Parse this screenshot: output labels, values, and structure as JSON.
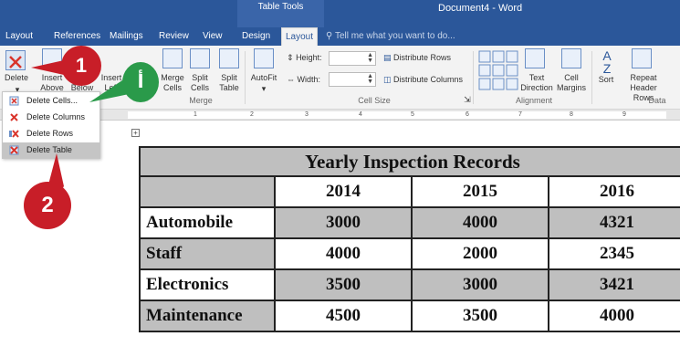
{
  "titlebar": {
    "context_tab": "Table Tools",
    "document_title": "Document4 - Word"
  },
  "tabs": [
    "Layout",
    "References",
    "Mailings",
    "Review",
    "View",
    "Design",
    "Layout"
  ],
  "tell_me": "Tell me what you want to do...",
  "ribbon": {
    "delete": "Delete",
    "insert_above": "Insert Above",
    "insert_below": "Below",
    "insert_left": "Insert Left",
    "merge_cells": "Merge Cells",
    "split_cells": "Split Cells",
    "split_table": "Split Table",
    "autofit": "AutoFit",
    "height": "Height:",
    "width": "Width:",
    "distribute_rows": "Distribute Rows",
    "distribute_columns": "Distribute Columns",
    "text_direction": "Text Direction",
    "cell_margins": "Cell Margins",
    "sort": "Sort",
    "repeat_header_rows": "Repeat Header Rows",
    "group_merge": "Merge",
    "group_cell_size": "Cell Size",
    "group_alignment": "Alignment",
    "group_data": "Data"
  },
  "menu": {
    "items": [
      "Delete Cells...",
      "Delete Columns",
      "Delete Rows",
      "Delete Table"
    ]
  },
  "callouts": {
    "one": "1",
    "two": "2",
    "alef": "أ"
  },
  "table": {
    "title": "Yearly Inspection Records",
    "years": [
      "2014",
      "2015",
      "2016"
    ],
    "rows": [
      {
        "label": "Automobile",
        "values": [
          "3000",
          "4000",
          "4321"
        ]
      },
      {
        "label": "Staff",
        "values": [
          "4000",
          "2000",
          "2345"
        ]
      },
      {
        "label": "Electronics",
        "values": [
          "3500",
          "3000",
          "3421"
        ]
      },
      {
        "label": "Maintenance",
        "values": [
          "4500",
          "3500",
          "4000"
        ]
      }
    ]
  },
  "ruler": {
    "numbers": [
      "1",
      "2",
      "3",
      "4",
      "5",
      "6",
      "7",
      "8",
      "9"
    ]
  },
  "colors": {
    "word_blue": "#2b579a",
    "callout_red": "#c81e28",
    "callout_green": "#2a9a4a",
    "table_fill": "#bfbfbf"
  }
}
